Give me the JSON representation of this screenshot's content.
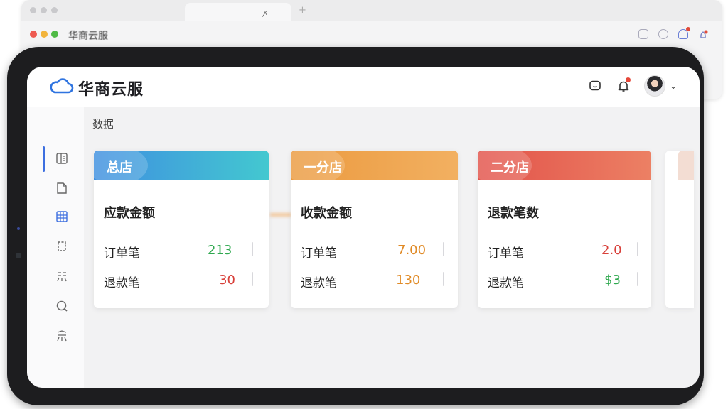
{
  "browser": {
    "tab_title": "",
    "window_title": "华商云服"
  },
  "app": {
    "title": "华商云服"
  },
  "header": {
    "icons": [
      "message-icon",
      "bell-icon",
      "avatar",
      "chevron-down-icon"
    ],
    "chevron": "⌄"
  },
  "sidebar": {
    "items": [
      "dashboard-icon",
      "document-icon",
      "grid-icon",
      "device-icon",
      "chart-icon",
      "search-icon",
      "category-icon"
    ]
  },
  "main": {
    "breadcrumb_visible": "数据",
    "breadcrumb_blurred": "",
    "section2_blurred": ""
  },
  "cards": [
    {
      "store": "总店",
      "metric": "应款金额",
      "rows": [
        {
          "label": "订单笔",
          "value": "213",
          "color": "#2fa84f"
        },
        {
          "label": "退款笔",
          "value": "30",
          "color": "#d8403a"
        }
      ],
      "header_gradient": [
        "#3f8fe0",
        "#43c8d0"
      ]
    },
    {
      "store": "一分店",
      "metric": "收款金额",
      "rows": [
        {
          "label": "订单笔",
          "value": "7.00",
          "color": "#e08a26"
        },
        {
          "label": "退款笔",
          "value": "130",
          "color": "#e08a26"
        }
      ],
      "header_gradient": [
        "#eb9a3f",
        "#f2b061"
      ]
    },
    {
      "store": "二分店",
      "metric": "退款笔数",
      "rows": [
        {
          "label": "订单笔",
          "value": "2.0",
          "color": "#d8403a"
        },
        {
          "label": "退款笔",
          "value": "$3",
          "color": "#2fa84f"
        }
      ],
      "header_gradient": [
        "#e2524a",
        "#ec8064"
      ]
    }
  ]
}
